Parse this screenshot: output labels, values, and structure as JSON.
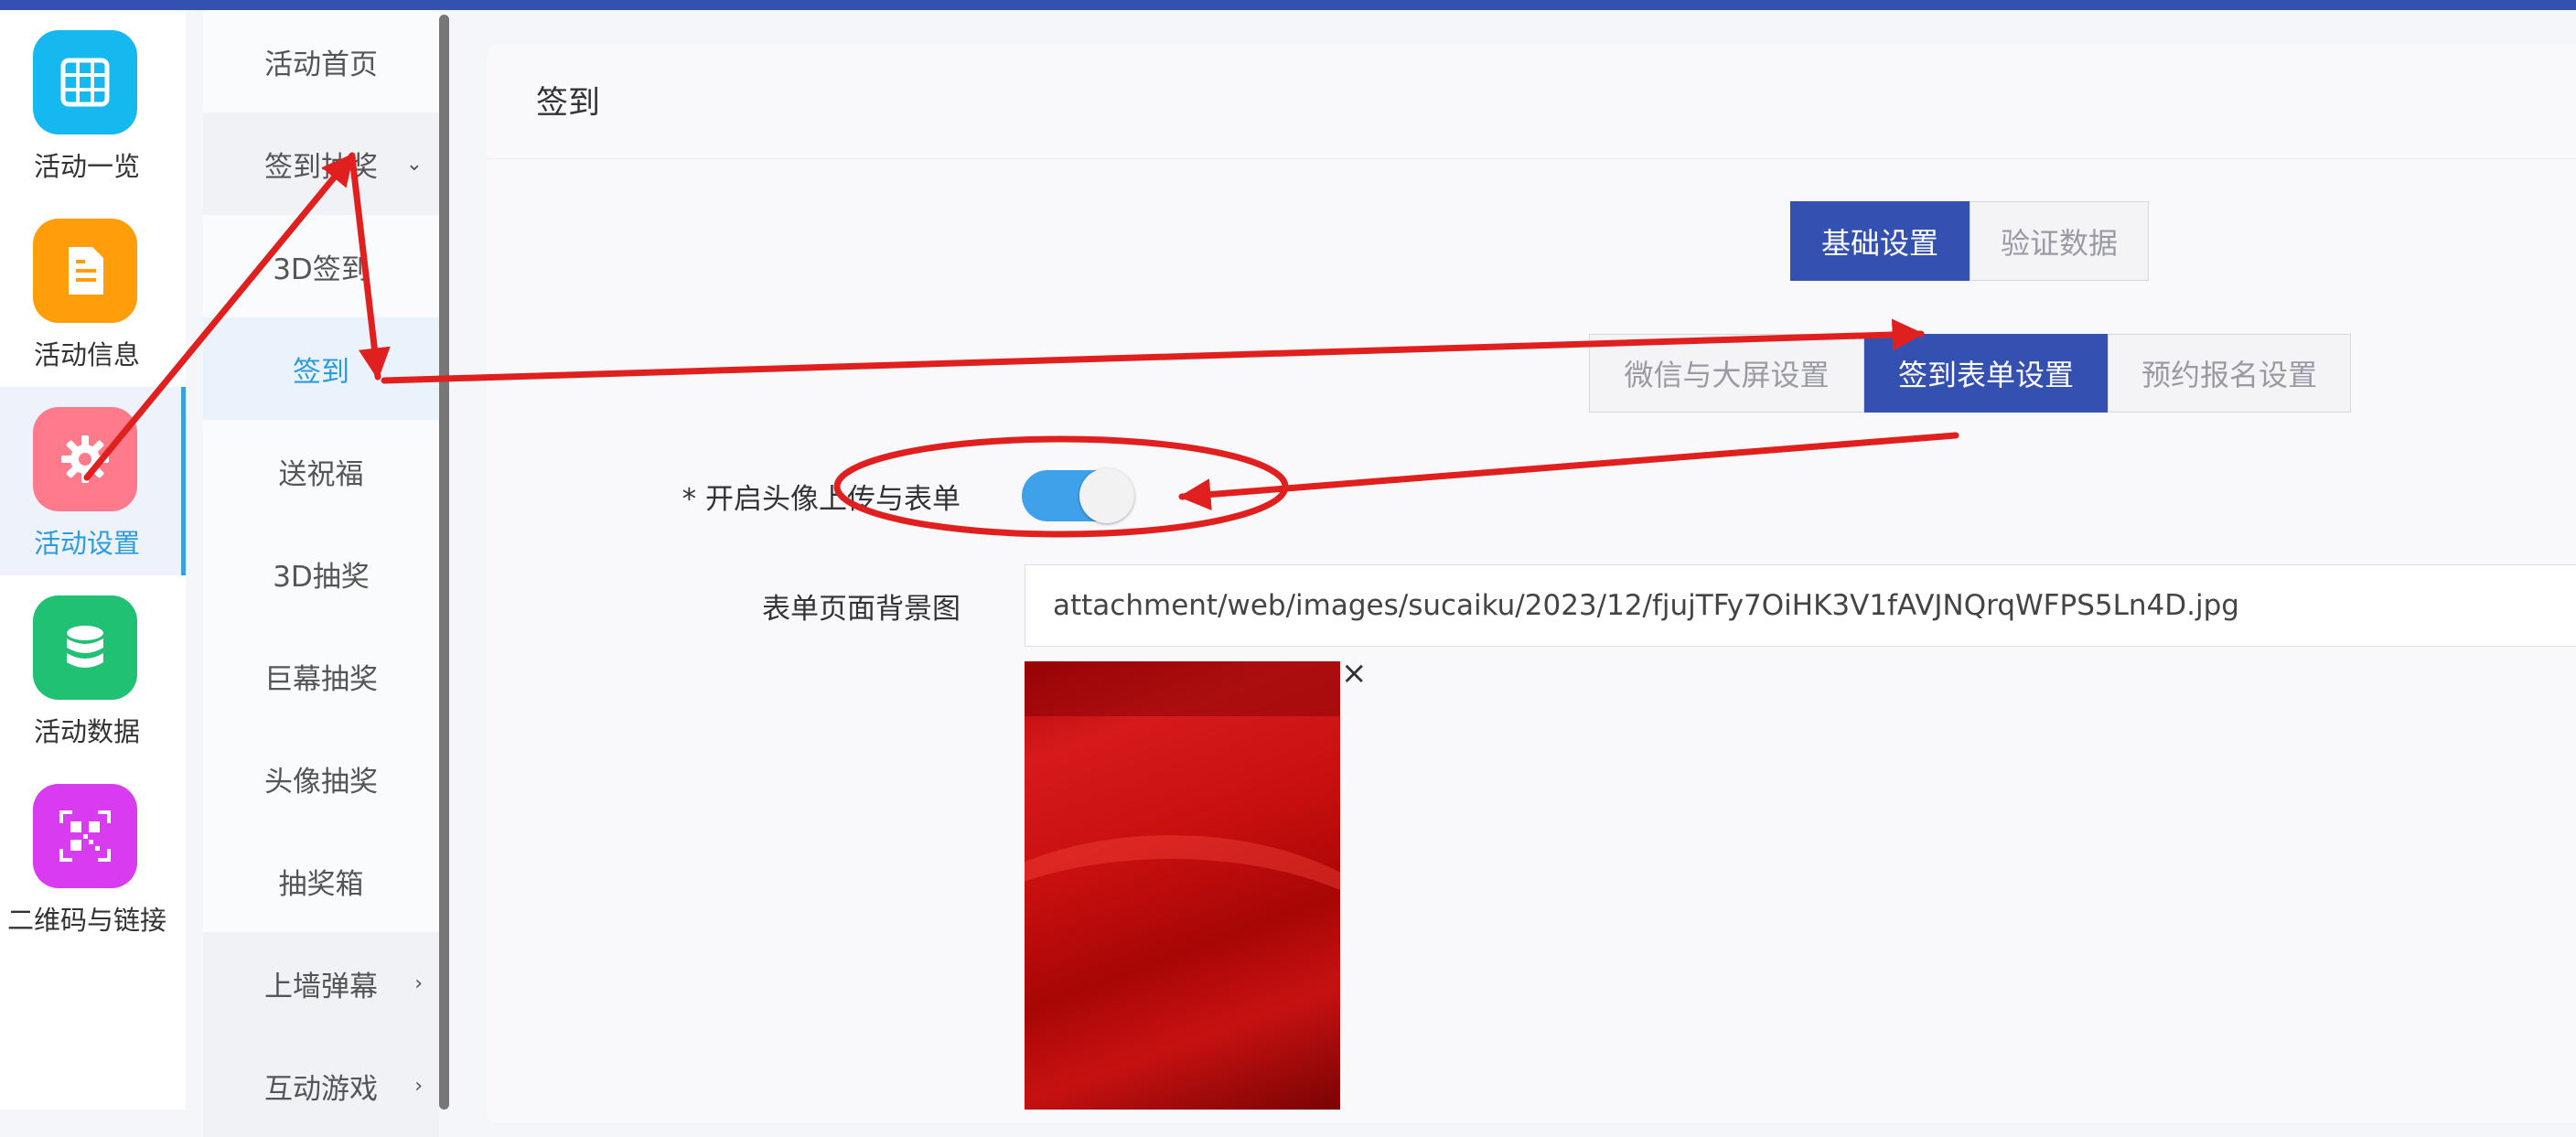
{
  "rail": [
    {
      "label": "活动一览",
      "icon": "grid-icon",
      "color": "#15b9f0"
    },
    {
      "label": "活动信息",
      "icon": "document-icon",
      "color": "#ff9d0b"
    },
    {
      "label": "活动设置",
      "icon": "gear-icon",
      "color": "#ff7a8a",
      "active": true
    },
    {
      "label": "活动数据",
      "icon": "database-icon",
      "color": "#21c174"
    },
    {
      "label": "二维码与链接",
      "icon": "qr-code-icon",
      "color": "#d93bf0"
    }
  ],
  "submenu": {
    "home": "活动首页",
    "signin_lottery": "签到抽奖",
    "sign3d": "3D签到",
    "signin": "签到",
    "blessing": "送祝福",
    "lottery3d": "3D抽奖",
    "giant_lottery": "巨幕抽奖",
    "avatar_lottery": "头像抽奖",
    "lottery_box": "抽奖箱",
    "danmaku": "上墙弹幕",
    "games": "互动游戏"
  },
  "main": {
    "title": "签到",
    "tabs_top": [
      "基础设置",
      "验证数据"
    ],
    "tabs_sub": [
      "微信与大屏设置",
      "签到表单设置",
      "预约报名设置"
    ],
    "avatar_label": "* 开启头像上传与表单",
    "avatar_enabled": true,
    "bg_label": "表单页面背景图",
    "bg_path": "attachment/web/images/sucaiku/2023/12/fjujTFy7OiHK3V1fAVJNQrqWFPS5Ln4D.jpg",
    "close_symbol": "×"
  },
  "colors": {
    "primary": "#3451b2",
    "accent": "#2d9cdb",
    "toggle_on": "#3fa1ea",
    "annotation": "#e0201f"
  }
}
